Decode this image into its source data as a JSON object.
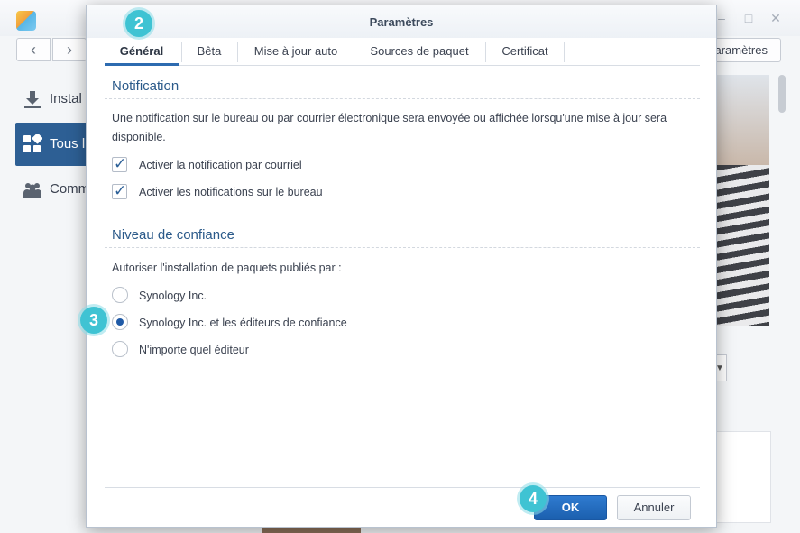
{
  "window": {
    "back_icon": "‹",
    "forward_icon": "›",
    "settings_button_label": "aramètres"
  },
  "sidebar": {
    "items": [
      {
        "label": "Instal",
        "icon": "download-icon"
      },
      {
        "label": "Tous l",
        "icon": "grid-icon"
      },
      {
        "label": "Comm",
        "icon": "community-icon"
      }
    ]
  },
  "dialog": {
    "title": "Paramètres",
    "tabs": [
      {
        "label": "Général",
        "active": true
      },
      {
        "label": "Bêta"
      },
      {
        "label": "Mise à jour auto"
      },
      {
        "label": "Sources de paquet"
      },
      {
        "label": "Certificat"
      }
    ],
    "notification": {
      "title": "Notification",
      "description": "Une notification sur le bureau ou par courrier électronique sera envoyée ou affichée lorsqu'une mise à jour sera disponible.",
      "options": [
        {
          "label": "Activer la notification par courriel",
          "checked": true
        },
        {
          "label": "Activer les notifications sur le bureau",
          "checked": true
        }
      ]
    },
    "trust": {
      "title": "Niveau de confiance",
      "prompt": "Autoriser l'installation de paquets publiés par :",
      "options": [
        {
          "label": "Synology Inc.",
          "selected": false
        },
        {
          "label": "Synology Inc. et les éditeurs de confiance",
          "selected": true
        },
        {
          "label": "N'importe quel éditeur",
          "selected": false
        }
      ]
    },
    "buttons": {
      "ok": "OK",
      "cancel": "Annuler"
    }
  },
  "badges": [
    "2",
    "3",
    "4"
  ],
  "colors": {
    "accent": "#2d6bb0",
    "badge": "#3fc3d3",
    "sidebar_active": "#2d5f94"
  }
}
